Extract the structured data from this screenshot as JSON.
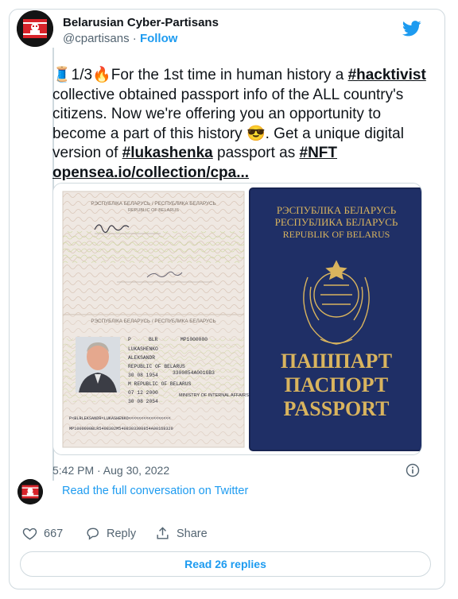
{
  "author": {
    "name": "Belarusian Cyber-Partisans",
    "handle": "@cpartisans",
    "separator": "·",
    "follow_label": "Follow"
  },
  "tweet": {
    "emoji_spool": "🧵",
    "counter": "1/3",
    "emoji_fire": "🔥",
    "text_1": "For the 1st time in human history a ",
    "hashtag_1": "#hacktivist",
    "text_2": " collective obtained passport info of the ALL country's citizens. Now we're offering you an opportunity to become a part of this history ",
    "emoji_cool": "😎",
    "text_3": ". Get a unique digital version of ",
    "hashtag_2": "#lukashenka",
    "text_4": " passport as ",
    "hashtag_3": "#NFT",
    "link": "opensea.io/collection/cpa..."
  },
  "passport": {
    "page_header": "РЭСПУБЛІКА БЕЛАРУСЬ / РЕСПУБЛИКА БЕЛАРУСЬ",
    "page_header_en": "REPUBLIC OF BELARUS",
    "type": "P",
    "code": "BLR",
    "number": "MP1000000",
    "surname": "LUKASHENKO",
    "given_name": "ALEKSANDR",
    "nationality": "REPUBLIC OF BELARUS",
    "personal_no": "3300854A001GB3",
    "date_of_birth": "30 08 1954",
    "sex_place": "M    REPUBLIC OF BELARUS",
    "date_of_issue": "07 12 2000",
    "date_of_expiry": "30 08 2054",
    "authority": "MINISTRY OF INTERNAL AFFAIRS",
    "mrz_1": "P<BLRLEKSANDR<LUKASHENKO<<<<<<<<<<<<<<<<<",
    "mrz_2": "MP1000000BLR5408302M5408303300854A00168320",
    "cover_line_1": "РЭСПУБЛІКА БЕЛАРУСЬ",
    "cover_line_2": "РЕСПУБЛИКА БЕЛАРУСЬ",
    "cover_line_3": "REPUBLIK OF BELARUS",
    "cover_title_1": "ПАШПАРТ",
    "cover_title_2": "ПАСПОРТ",
    "cover_title_3": "PASSPORT"
  },
  "meta": {
    "timestamp": "5:42 PM · Aug 30, 2022",
    "read_conversation": "Read the full conversation on Twitter"
  },
  "actions": {
    "likes": "667",
    "reply_label": "Reply",
    "share_label": "Share",
    "read_replies": "Read 26 replies"
  },
  "colors": {
    "twitter_blue": "#1d9bf0",
    "passport_cover": "#1f2f66",
    "passport_gold": "#d9b45e"
  }
}
